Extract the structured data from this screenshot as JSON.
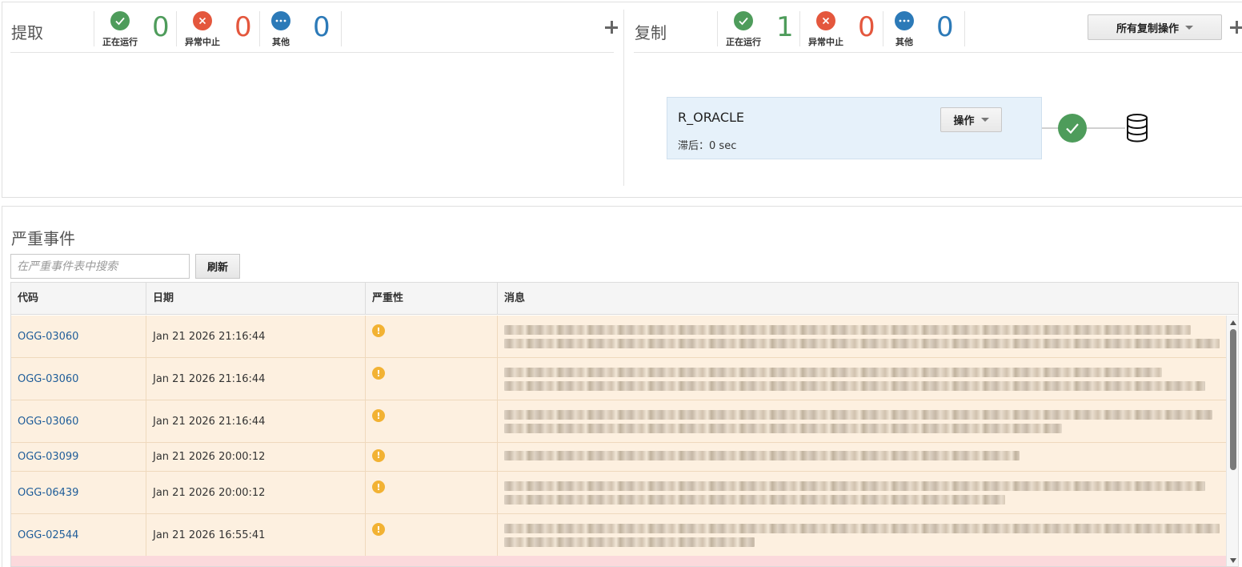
{
  "extract": {
    "title": "提取",
    "stats": [
      {
        "label": "正在运行",
        "value": "0",
        "color": "#4e9c5b",
        "icon": "check-icon"
      },
      {
        "label": "异常中止",
        "value": "0",
        "color": "#e4573d",
        "icon": "x-icon"
      },
      {
        "label": "其他",
        "value": "0",
        "color": "#2c7ab8",
        "icon": "ellipsis-icon"
      }
    ]
  },
  "replicat": {
    "title": "复制",
    "stats": [
      {
        "label": "正在运行",
        "value": "1",
        "color": "#4e9c5b",
        "icon": "check-icon"
      },
      {
        "label": "异常中止",
        "value": "0",
        "color": "#e4573d",
        "icon": "x-icon"
      },
      {
        "label": "其他",
        "value": "0",
        "color": "#2c7ab8",
        "icon": "ellipsis-icon"
      }
    ],
    "all_ops_label": "所有复制操作",
    "card": {
      "name": "R_ORACLE",
      "lag_label": "滞后：",
      "lag_value": "0 sec",
      "action_label": "操作"
    }
  },
  "events": {
    "title": "严重事件",
    "search_placeholder": "在严重事件表中搜索",
    "refresh_label": "刷新",
    "columns": [
      "代码",
      "日期",
      "严重性",
      "消息"
    ],
    "rows": [
      {
        "code": "OGG-03060",
        "date": "Jan 21 2026 21:16:44",
        "severity": "warning"
      },
      {
        "code": "OGG-03060",
        "date": "Jan 21 2026 21:16:44",
        "severity": "warning"
      },
      {
        "code": "OGG-03060",
        "date": "Jan 21 2026 21:16:44",
        "severity": "warning"
      },
      {
        "code": "OGG-03099",
        "date": "Jan 21 2026 20:00:12",
        "severity": "warning"
      },
      {
        "code": "OGG-06439",
        "date": "Jan 21 2026 20:00:12",
        "severity": "warning"
      },
      {
        "code": "OGG-02544",
        "date": "Jan 21 2026 16:55:41",
        "severity": "warning"
      }
    ]
  }
}
